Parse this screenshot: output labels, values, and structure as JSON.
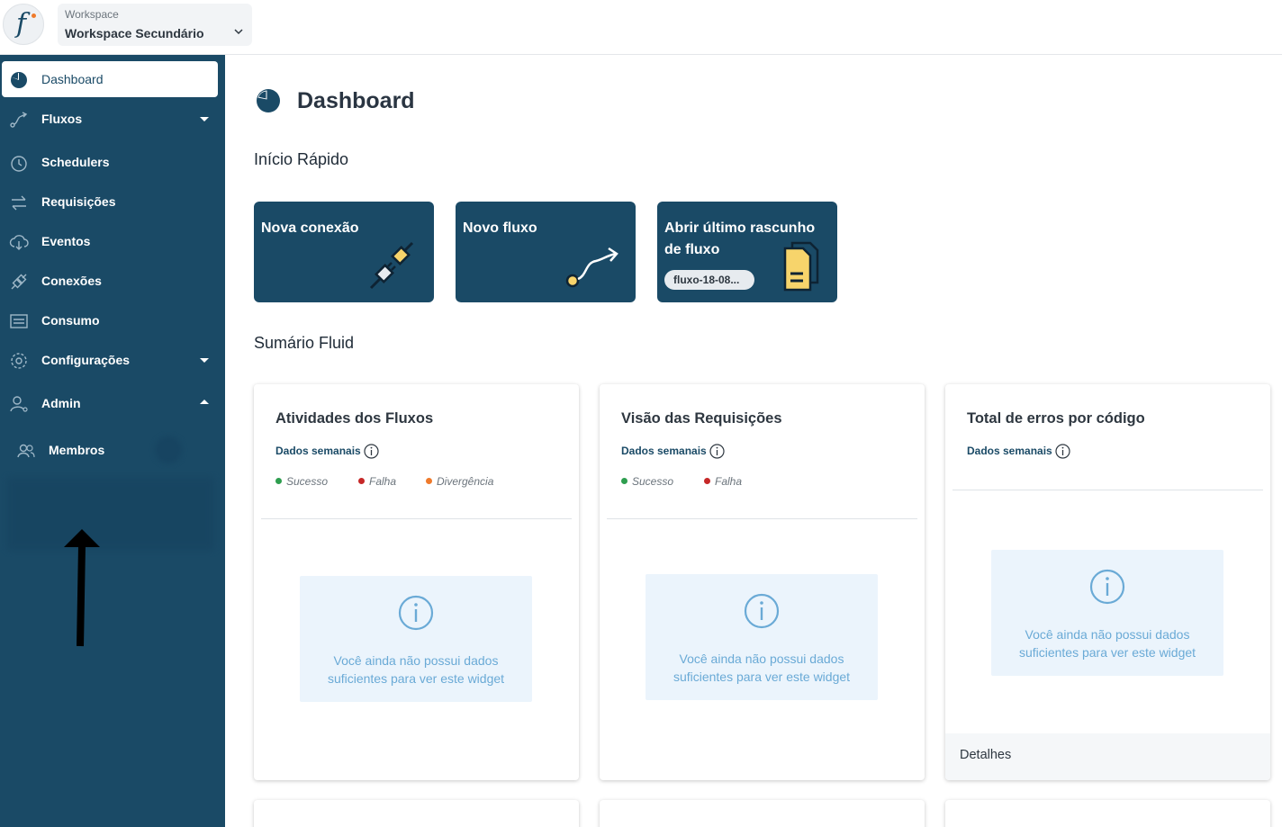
{
  "header": {
    "workspace_label": "Workspace",
    "workspace_value": "Workspace Secundário",
    "logo_letter": "f"
  },
  "sidebar": {
    "items": [
      {
        "label": "Dashboard",
        "icon": "dashboard-pie-icon",
        "active": true
      },
      {
        "label": "Fluxos",
        "icon": "flow-icon",
        "caret": "down"
      },
      {
        "label": "Schedulers",
        "icon": "clock-icon"
      },
      {
        "label": "Requisições",
        "icon": "arrows-exchange-icon"
      },
      {
        "label": "Eventos",
        "icon": "cloud-download-icon"
      },
      {
        "label": "Conexões",
        "icon": "plug-icon"
      },
      {
        "label": "Consumo",
        "icon": "list-box-icon"
      },
      {
        "label": "Configurações",
        "icon": "gear-icon",
        "caret": "down"
      },
      {
        "label": "Admin",
        "icon": "user-gear-icon",
        "caret": "up"
      },
      {
        "label": "Membros",
        "icon": "users-icon",
        "sub": true
      }
    ]
  },
  "main": {
    "title": "Dashboard",
    "quick_start_title": "Início Rápido",
    "quick_cards": [
      {
        "title": "Nova conexão",
        "icon": "plug-connect-icon"
      },
      {
        "title": "Novo fluxo",
        "icon": "flow-arrow-icon"
      },
      {
        "title": "Abrir último rascunho de fluxo",
        "icon": "draft-document-icon",
        "pill": "fluxo-18-08..."
      }
    ],
    "summary_title": "Sumário Fluid",
    "widgets": [
      {
        "title": "Atividades dos Fluxos",
        "subtitle": "Dados semanais",
        "legend": [
          {
            "label": "Sucesso",
            "color": "#2e9e4f"
          },
          {
            "label": "Falha",
            "color": "#c62828"
          },
          {
            "label": "Divergência",
            "color": "#ef7a2b"
          }
        ],
        "empty_line1": "Você ainda não possui dados",
        "empty_line2": "suficientes para ver este widget"
      },
      {
        "title": "Visão das Requisições",
        "subtitle": "Dados semanais",
        "legend": [
          {
            "label": "Sucesso",
            "color": "#2e9e4f"
          },
          {
            "label": "Falha",
            "color": "#c62828"
          }
        ],
        "empty_line1": "Você ainda não possui dados",
        "empty_line2": "suficientes para ver este widget"
      },
      {
        "title": "Total de erros por código",
        "subtitle": "Dados semanais",
        "empty_line1": "Você ainda não possui dados",
        "empty_line2": "suficientes para ver este widget",
        "details_link": "Detalhes"
      }
    ]
  },
  "colors": {
    "brand": "#1a4a66",
    "accent_yellow": "#f7d46b",
    "empty_text": "#6aaad6",
    "empty_bg": "#ebf4fc"
  }
}
